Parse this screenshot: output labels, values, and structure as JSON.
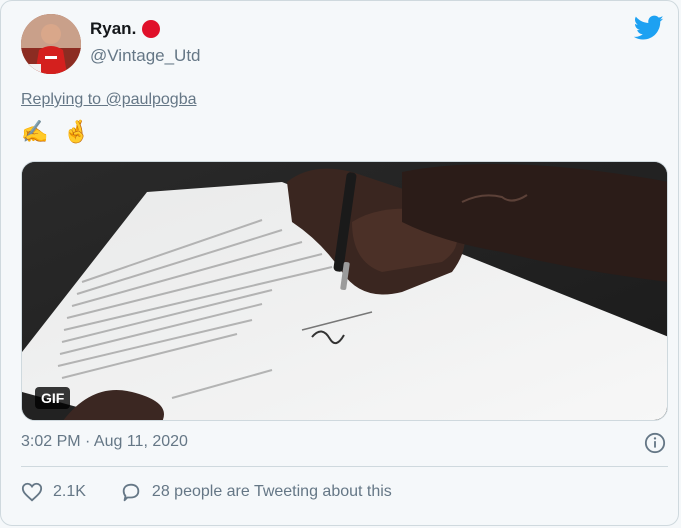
{
  "author": {
    "name": "Ryan.",
    "handle": "@Vintage_Utd"
  },
  "reply": {
    "prefix": "Replying to",
    "target": "@paulpogba"
  },
  "tweet": {
    "text": "✍️ 🤞"
  },
  "media": {
    "badge": "GIF"
  },
  "meta": {
    "timestamp": "3:02 PM · Aug 11, 2020"
  },
  "actions": {
    "likes": "2.1K",
    "comments_text": "28 people are Tweeting about this"
  },
  "colors": {
    "brand": "#1da1f2",
    "muted": "#657786",
    "status_dot": "#e0102a"
  }
}
